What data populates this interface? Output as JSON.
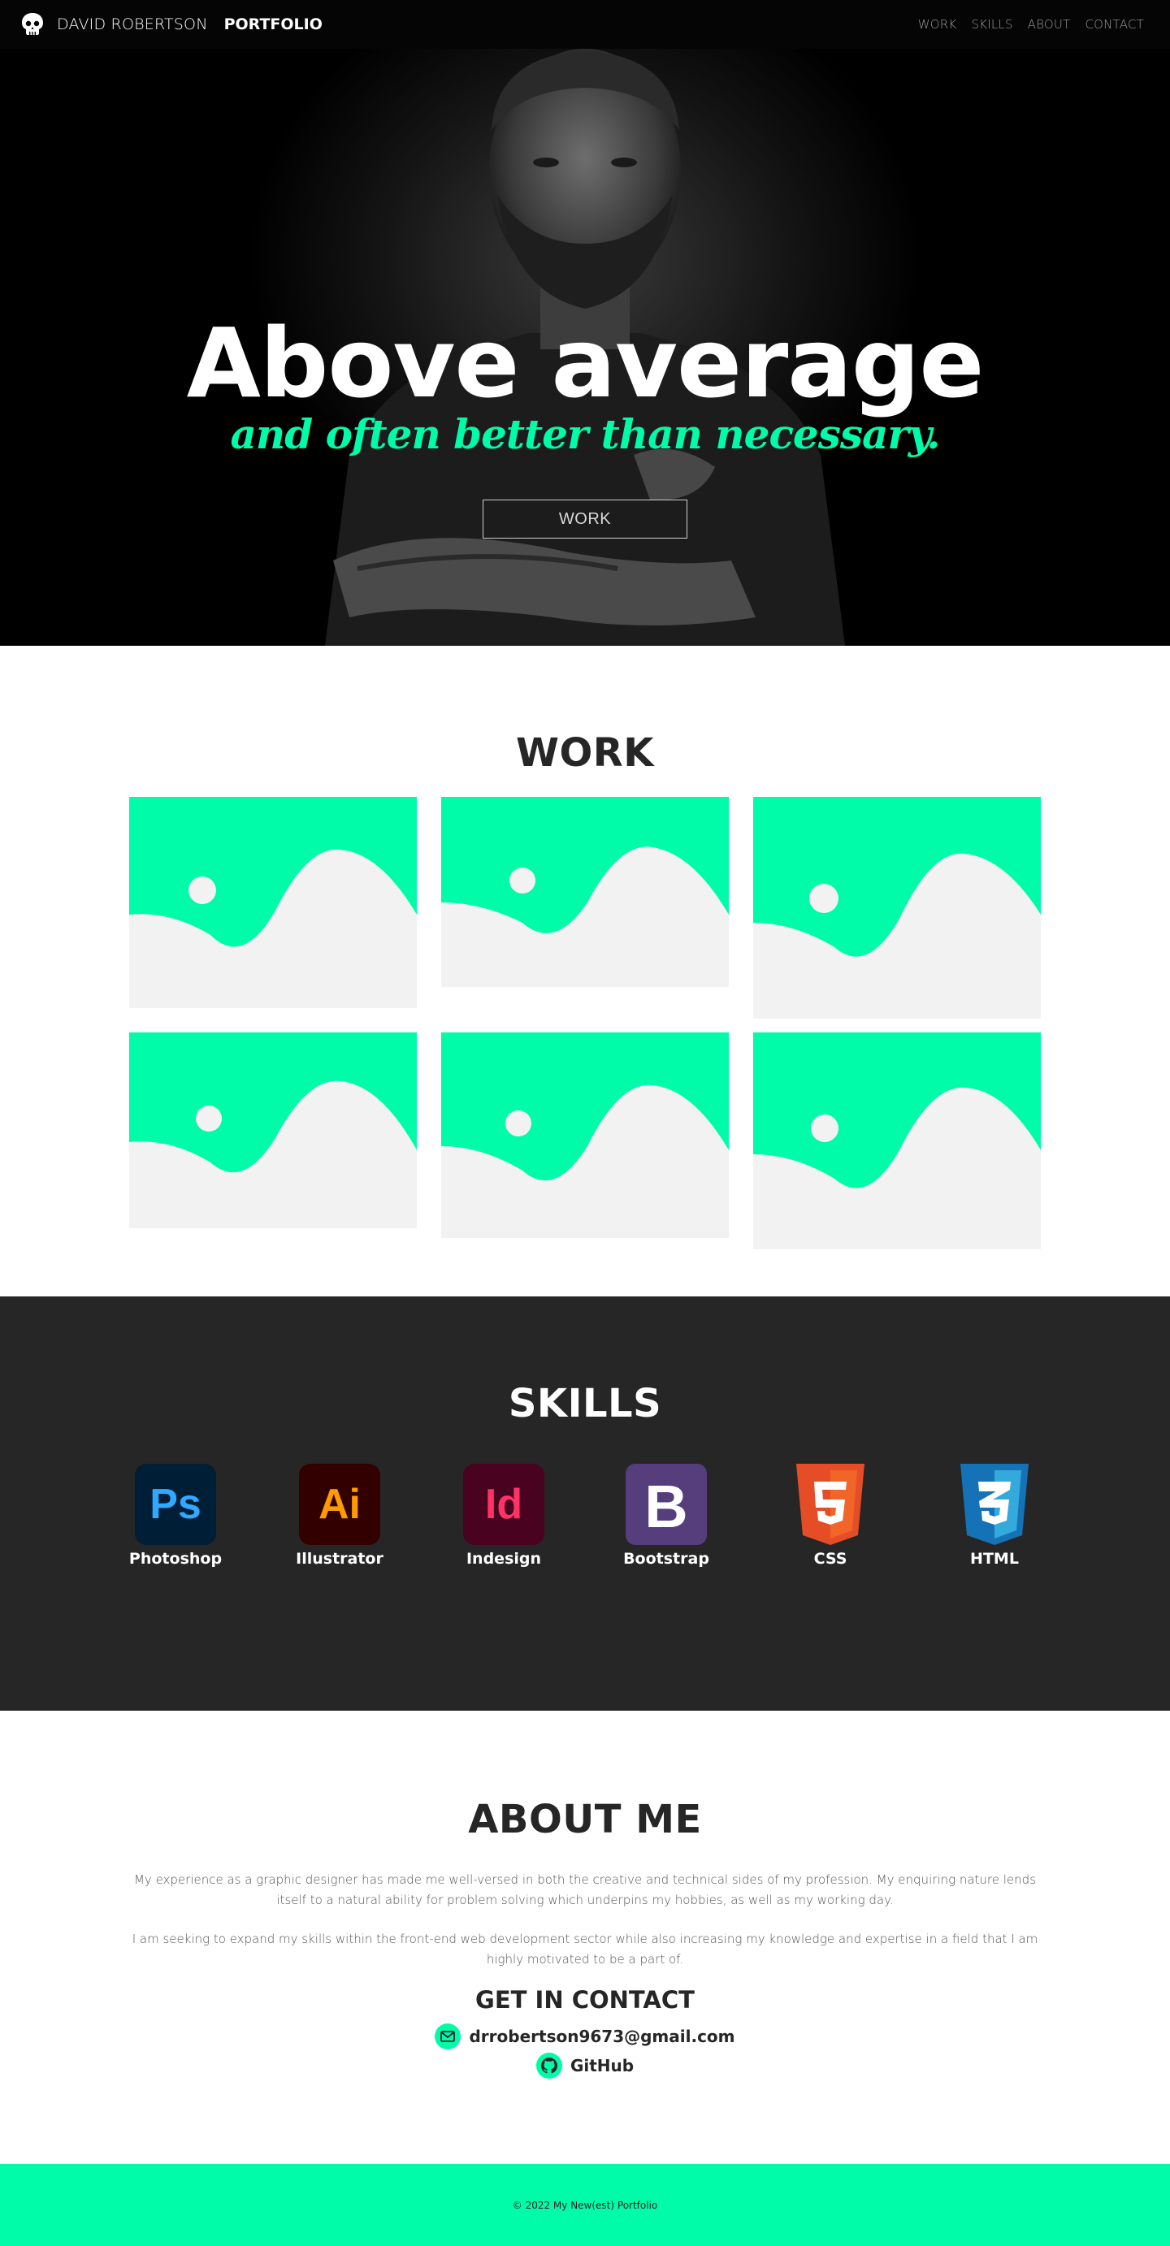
{
  "nav": {
    "brand_name": "DAVID ROBERTSON",
    "brand_strong": "PORTFOLIO",
    "logo_icon": "skull-icon",
    "links": [
      "WORK",
      "SKILLS",
      "ABOUT",
      "CONTACT"
    ]
  },
  "hero": {
    "title": "Above average",
    "subtitle": "and often better than necessary.",
    "button": "WORK"
  },
  "work": {
    "title": "WORK",
    "thumbnails": [
      "image-placeholder-icon",
      "image-placeholder-icon",
      "image-placeholder-icon",
      "image-placeholder-icon",
      "image-placeholder-icon",
      "image-placeholder-icon"
    ]
  },
  "skills": {
    "title": "SKILLS",
    "items": [
      {
        "label": "Photoshop",
        "icon": "photoshop-icon"
      },
      {
        "label": "Illustrator",
        "icon": "illustrator-icon"
      },
      {
        "label": "Indesign",
        "icon": "indesign-icon"
      },
      {
        "label": "Bootstrap",
        "icon": "bootstrap-icon"
      },
      {
        "label": "CSS",
        "icon": "css-icon"
      },
      {
        "label": "HTML",
        "icon": "html-icon"
      }
    ]
  },
  "about": {
    "title": "ABOUT ME",
    "paragraph1": "My experience as a graphic designer has made me well-versed in both the creative and technical sides of my profession. My enquiring nature lends itself to a natural ability for problem solving which underpins my hobbies, as well as my working day.",
    "paragraph2": "I am seeking to expand my skills within the front-end web development sector while also increasing my knowledge and expertise in a field that I am highly motivated to be a part of.",
    "contact_title": "GET IN CONTACT",
    "email": "drrobertson9673@gmail.com",
    "github": "GitHub"
  },
  "footer": {
    "text": "© 2022 My New(est) Portfolio"
  },
  "colors": {
    "accent": "#00fca9",
    "dark": "#262626",
    "nav_bg": "#050505",
    "placeholder_bg": "#f2f2f2"
  }
}
